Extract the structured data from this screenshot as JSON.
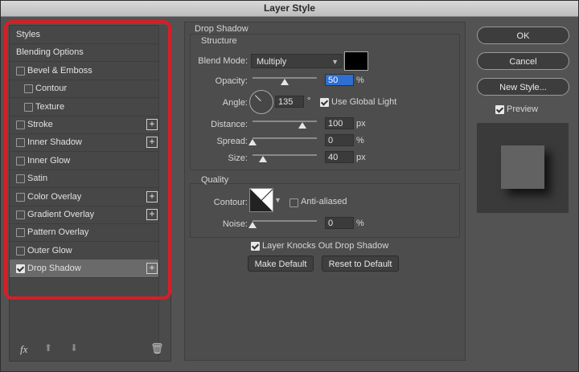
{
  "window": {
    "title": "Layer Style"
  },
  "style_list": {
    "items": [
      {
        "label": "Styles",
        "checkbox": false,
        "checked": false,
        "plus": false,
        "indent": 0,
        "selected": false
      },
      {
        "label": "Blending Options",
        "checkbox": false,
        "checked": false,
        "plus": false,
        "indent": 0,
        "selected": false
      },
      {
        "label": "Bevel & Emboss",
        "checkbox": true,
        "checked": false,
        "plus": false,
        "indent": 0,
        "selected": false
      },
      {
        "label": "Contour",
        "checkbox": true,
        "checked": false,
        "plus": false,
        "indent": 1,
        "selected": false
      },
      {
        "label": "Texture",
        "checkbox": true,
        "checked": false,
        "plus": false,
        "indent": 1,
        "selected": false
      },
      {
        "label": "Stroke",
        "checkbox": true,
        "checked": false,
        "plus": true,
        "indent": 0,
        "selected": false
      },
      {
        "label": "Inner Shadow",
        "checkbox": true,
        "checked": false,
        "plus": true,
        "indent": 0,
        "selected": false
      },
      {
        "label": "Inner Glow",
        "checkbox": true,
        "checked": false,
        "plus": false,
        "indent": 0,
        "selected": false
      },
      {
        "label": "Satin",
        "checkbox": true,
        "checked": false,
        "plus": false,
        "indent": 0,
        "selected": false
      },
      {
        "label": "Color Overlay",
        "checkbox": true,
        "checked": false,
        "plus": true,
        "indent": 0,
        "selected": false
      },
      {
        "label": "Gradient Overlay",
        "checkbox": true,
        "checked": false,
        "plus": true,
        "indent": 0,
        "selected": false
      },
      {
        "label": "Pattern Overlay",
        "checkbox": true,
        "checked": false,
        "plus": false,
        "indent": 0,
        "selected": false
      },
      {
        "label": "Outer Glow",
        "checkbox": true,
        "checked": false,
        "plus": false,
        "indent": 0,
        "selected": false
      },
      {
        "label": "Drop Shadow",
        "checkbox": true,
        "checked": true,
        "plus": true,
        "indent": 0,
        "selected": true
      }
    ],
    "plus_glyph": "+",
    "fx_label": "fx",
    "up_glyph": "⬆",
    "down_glyph": "⬇",
    "trash_glyph": "🗑"
  },
  "drop_shadow": {
    "section_title": "Drop Shadow",
    "structure_title": "Structure",
    "blend_mode": {
      "label": "Blend Mode:",
      "value": "Multiply"
    },
    "shadow_color": "#000000",
    "opacity": {
      "label": "Opacity:",
      "value": "50",
      "unit": "%",
      "slider_fraction": 0.5
    },
    "angle": {
      "label": "Angle:",
      "value": "135",
      "unit": "°",
      "use_global_light_label": "Use Global Light",
      "use_global_light_checked": true
    },
    "distance": {
      "label": "Distance:",
      "value": "100",
      "unit": "px",
      "slider_fraction": 0.77
    },
    "spread": {
      "label": "Spread:",
      "value": "0",
      "unit": "%",
      "slider_fraction": 0.0
    },
    "size": {
      "label": "Size:",
      "value": "40",
      "unit": "px",
      "slider_fraction": 0.16
    },
    "quality_title": "Quality",
    "contour": {
      "label": "Contour:",
      "anti_aliased_label": "Anti-aliased",
      "anti_aliased_checked": false
    },
    "noise": {
      "label": "Noise:",
      "value": "0",
      "unit": "%",
      "slider_fraction": 0.0
    },
    "knocks_out_label": "Layer Knocks Out Drop Shadow",
    "knocks_out_checked": true,
    "make_default_label": "Make Default",
    "reset_default_label": "Reset to Default"
  },
  "actions": {
    "ok_label": "OK",
    "cancel_label": "Cancel",
    "new_style_label": "New Style...",
    "preview_label": "Preview",
    "preview_checked": true
  },
  "colors": {
    "highlight": "#d61f26",
    "accent_selection": "#2f6fd1"
  }
}
